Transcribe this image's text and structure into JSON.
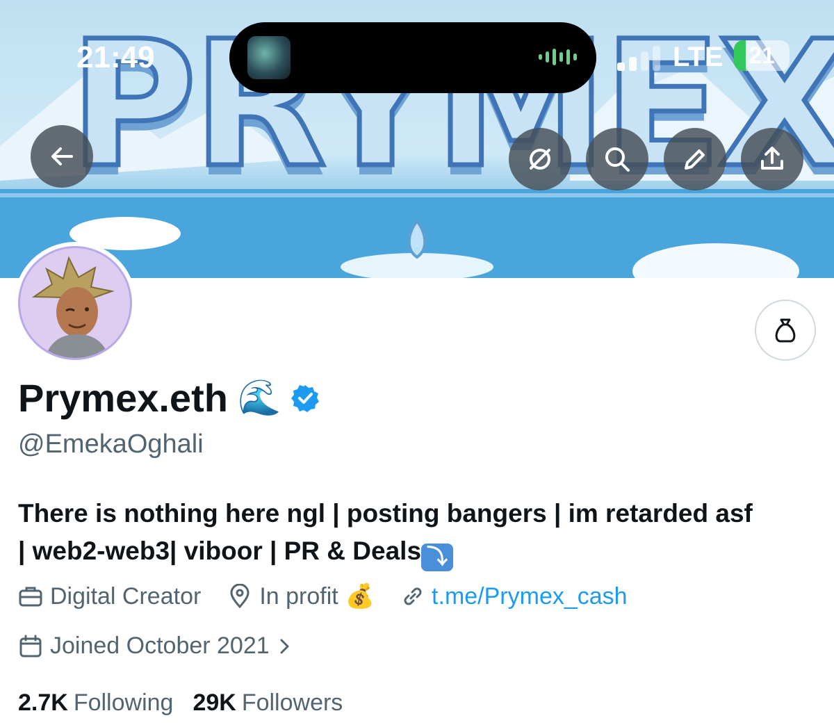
{
  "status_bar": {
    "time": "21:49",
    "network": "LTE",
    "battery": "21",
    "battery_level_percent": 21
  },
  "banner": {
    "title": "PRYMEX",
    "buttons": [
      {
        "name": "back",
        "icon": "arrow-left-icon"
      },
      {
        "name": "grok",
        "icon": "grok-icon"
      },
      {
        "name": "search",
        "icon": "search-icon"
      },
      {
        "name": "edit",
        "icon": "pencil-icon"
      },
      {
        "name": "share",
        "icon": "share-icon"
      }
    ]
  },
  "profile": {
    "display_name": "Prymex.eth",
    "name_emoji": "🌊",
    "verified": true,
    "handle": "@EmekaOghali",
    "bio_line1": "There is nothing here ngl | posting bangers | im retarded asf",
    "bio_line2": "| web2-web3| viboor | PR & Deals",
    "bio_emoji": "⤵",
    "category": "Digital Creator",
    "location": "In profit",
    "location_emoji": "💰",
    "link": "t.me/Prymex_cash",
    "joined": "Joined October 2021",
    "following_count": "2.7K",
    "following_label": "Following",
    "followers_count": "29K",
    "followers_label": "Followers"
  },
  "colors": {
    "accent": "#1d9bf0",
    "secondary_text": "#536471",
    "primary_text": "#0f1419",
    "battery_green": "#34c759"
  }
}
